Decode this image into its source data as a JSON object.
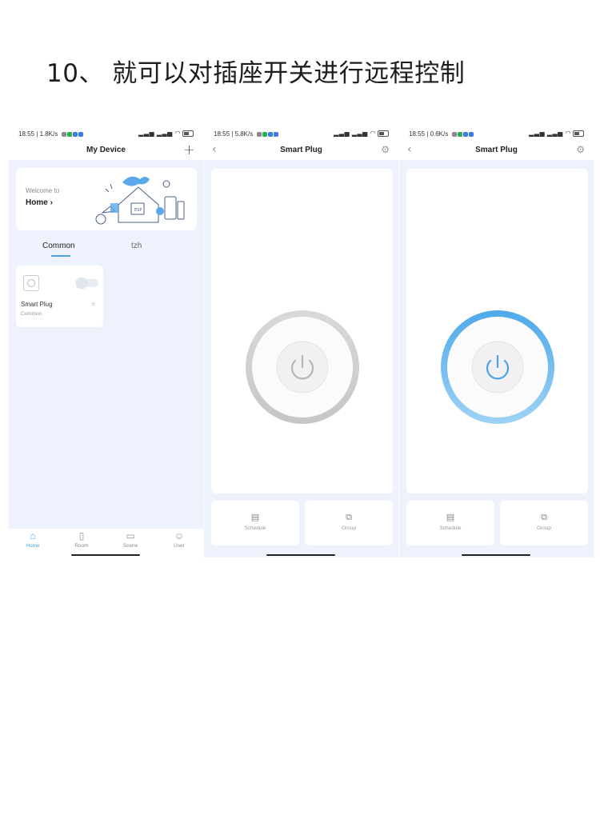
{
  "caption": "10、 就可以对插座开关进行远程控制",
  "phones": [
    {
      "status": {
        "time": "18:55",
        "speed": "1.8K/s"
      },
      "title": "My Device",
      "welcome": {
        "line1": "Welcome to",
        "home_label": "Home"
      },
      "tabs": [
        {
          "label": "Common"
        },
        {
          "label": "tzh"
        }
      ],
      "device": {
        "name": "Smart Plug",
        "room": "Common"
      },
      "bottom_nav": [
        {
          "label": "Home",
          "icon": "home-icon"
        },
        {
          "label": "Room",
          "icon": "door-icon"
        },
        {
          "label": "Scene",
          "icon": "scene-icon"
        },
        {
          "label": "User",
          "icon": "user-icon"
        }
      ]
    },
    {
      "status": {
        "time": "18:55",
        "speed": "5.8K/s"
      },
      "title": "Smart Plug",
      "power_state": "off",
      "actions": [
        {
          "label": "Schedule"
        },
        {
          "label": "Group"
        }
      ]
    },
    {
      "status": {
        "time": "18:55",
        "speed": "0.6K/s"
      },
      "title": "Smart Plug",
      "power_state": "on",
      "actions": [
        {
          "label": "Schedule"
        },
        {
          "label": "Group"
        }
      ]
    }
  ],
  "colors": {
    "accent": "#4aa3e8",
    "background": "#eef2fd",
    "ring_off": "#d4d4d4",
    "ring_on": "#5bb2ec"
  }
}
